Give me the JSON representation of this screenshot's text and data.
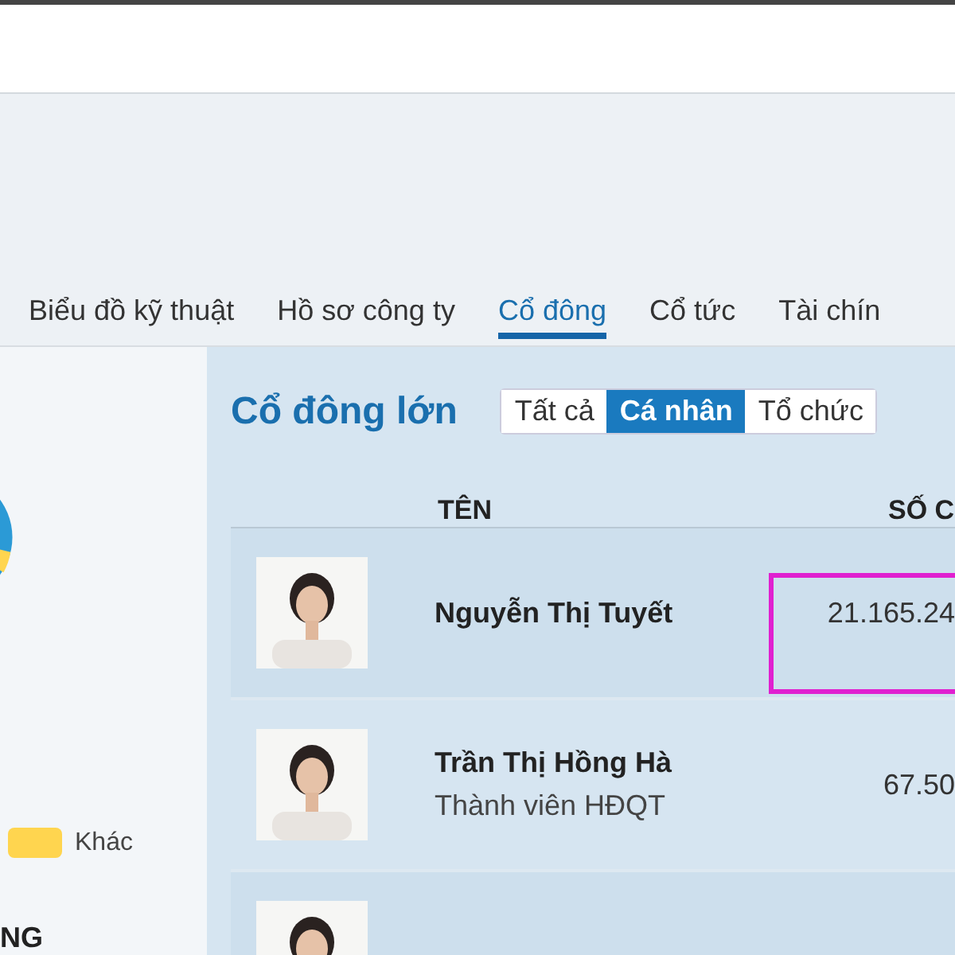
{
  "tabs": [
    {
      "label": "Biểu đồ kỹ thuật",
      "selected": false
    },
    {
      "label": "Hồ sơ công ty",
      "selected": false
    },
    {
      "label": "Cổ đông",
      "selected": true
    },
    {
      "label": "Cổ tức",
      "selected": false
    },
    {
      "label": "Tài chín",
      "selected": false
    }
  ],
  "sidebar": {
    "legend": [
      {
        "label": "Khác",
        "color": "#ffd54f"
      }
    ],
    "heading": "NG"
  },
  "panel": {
    "title": "Cổ đông lớn",
    "filters": [
      {
        "label": "Tất cả",
        "selected": false
      },
      {
        "label": "Cá nhân",
        "selected": true
      },
      {
        "label": "Tổ chức",
        "selected": false
      }
    ],
    "columns": [
      "TÊN",
      "SỐ C"
    ],
    "rows": [
      {
        "name": "Nguyễn Thị Tuyết",
        "shares": "21.165.24",
        "annotated": true
      },
      {
        "name": "Trần Thị Hồng Hà",
        "role": "Thành viên HĐQT",
        "shares": "67.50",
        "annotated": false
      },
      {
        "annotated": false
      }
    ]
  }
}
